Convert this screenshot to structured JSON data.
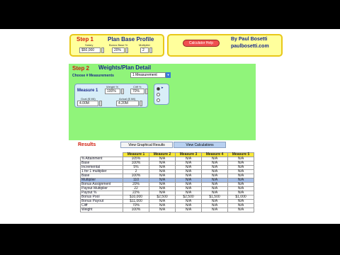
{
  "step1": {
    "label": "Step 1",
    "title": "Plan Base Profile",
    "fields": [
      {
        "label": "Salary",
        "value": "$50,000"
      },
      {
        "label": "Bonus Base %",
        "value": "20%"
      },
      {
        "label": "Multiplier",
        "value": "2"
      }
    ]
  },
  "header": {
    "calculator_button": "Calculator Help",
    "author_line1": "By Paul Bosetti",
    "author_line2": "paulbosetti.com"
  },
  "step2": {
    "label": "Step 2",
    "title": "Weights/Plan Detail",
    "choose_label": "Choose # Measurements",
    "choose_value": "1 Measurement",
    "measure": {
      "name": "Measure 1",
      "weight_label": "Weight %",
      "weight_value": "100%",
      "cliff_label": "Cliff %",
      "cliff_value": "70%",
      "goal_label": "Goal ($ Mil)",
      "goal_value": "4.00M",
      "actual_label": "Actual ($ Mil)",
      "actual_value": "4.20M"
    }
  },
  "results": {
    "label": "Results",
    "btn_graph": "View Graphical Results",
    "btn_calc": "View Calculations",
    "columns": [
      "Measure 1",
      "Measure 2",
      "Measure 3",
      "Measure 4",
      "Measure 5"
    ],
    "rows": [
      {
        "label": "% Attainment",
        "values": [
          "105%",
          "N/A",
          "N/A",
          "N/A",
          "N/A"
        ]
      },
      {
        "label": "Base",
        "values": [
          "100%",
          "N/A",
          "N/A",
          "N/A",
          "N/A"
        ]
      },
      {
        "label": "Incremental",
        "values": [
          "5%",
          "N/A",
          "N/A",
          "N/A",
          "N/A"
        ]
      },
      {
        "label": "1 for 1 multiplier",
        "values": [
          "2",
          "N/A",
          "N/A",
          "N/A",
          "N/A"
        ]
      },
      {
        "label": "Base",
        "values": [
          "100%",
          "N/A",
          "N/A",
          "N/A",
          "N/A"
        ]
      },
      {
        "label": "Multiplier",
        "values": [
          "110",
          "N/A",
          "N/A",
          "N/A",
          "N/A"
        ],
        "highlight": true
      },
      {
        "label": "Bonus Assignment",
        "values": [
          "20%",
          "N/A",
          "N/A",
          "N/A",
          "N/A"
        ]
      },
      {
        "label": "Payout Multiplier",
        "values": [
          "22",
          "N/A",
          "N/A",
          "N/A",
          "N/A"
        ]
      },
      {
        "label": "Payout %",
        "values": [
          "22%",
          "N/A",
          "N/A",
          "N/A",
          "N/A"
        ]
      },
      {
        "label": "Bonus Pool",
        "values": [
          "$10,000",
          "$2,500",
          "$2,500",
          "$1,500",
          "$1,000"
        ]
      },
      {
        "label": "Bonus Payout",
        "values": [
          "$11,000",
          "N/A",
          "N/A",
          "N/A",
          "N/A"
        ]
      },
      {
        "label": "Cliff",
        "values": [
          "70%",
          "N/A",
          "N/A",
          "N/A",
          "N/A"
        ]
      },
      {
        "label": "Weight",
        "values": [
          "100%",
          "N/A",
          "N/A",
          "N/A",
          "N/A"
        ]
      }
    ]
  }
}
